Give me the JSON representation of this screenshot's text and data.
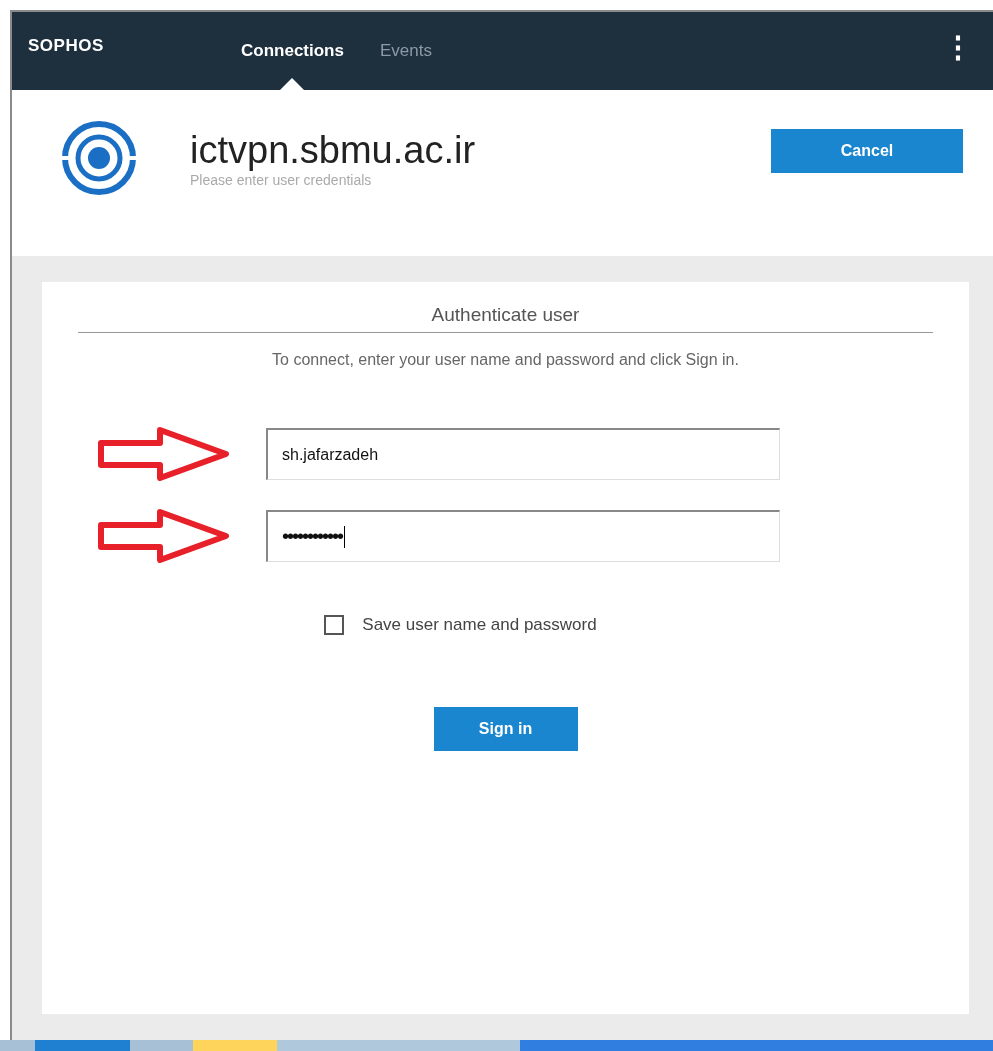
{
  "header": {
    "logo": "SOPHOS",
    "tabs": [
      {
        "label": "Connections",
        "selected": true
      },
      {
        "label": "Events",
        "selected": false
      }
    ],
    "menu_icon": "⋮"
  },
  "connection": {
    "name": "ictvpn.sbmu.ac.ir",
    "status": "Please enter user credentials",
    "cancel": "Cancel"
  },
  "auth": {
    "title": "Authenticate user",
    "instructions": "To connect, enter your user name and password and click Sign in.",
    "fields": [
      {
        "kind": "text",
        "value": "sh.jafarzadeh",
        "focused": false
      },
      {
        "kind": "password",
        "value": "••••••••••••",
        "focused": true
      }
    ],
    "save": {
      "label": "Save user name and password",
      "checked": false
    },
    "sign_in": "Sign in"
  }
}
